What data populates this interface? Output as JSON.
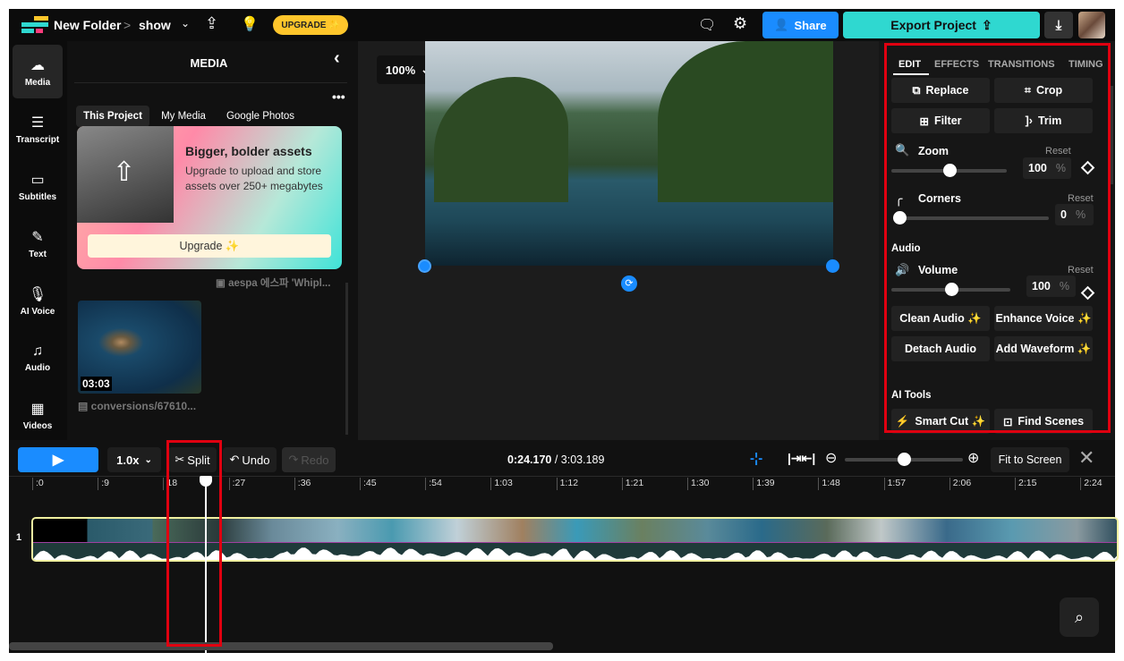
{
  "header": {
    "breadcrumb_folder": "New Folder",
    "breadcrumb_sep": ">",
    "project_name": "show",
    "upgrade": "UPGRADE ✨",
    "share": "Share",
    "export": "Export Project"
  },
  "rail": [
    {
      "label": "Media",
      "icon": "upload-cloud-icon"
    },
    {
      "label": "Transcript",
      "icon": "transcript-icon"
    },
    {
      "label": "Subtitles",
      "icon": "subtitles-icon"
    },
    {
      "label": "Text",
      "icon": "text-icon"
    },
    {
      "label": "AI Voice",
      "icon": "mic-icon"
    },
    {
      "label": "Audio",
      "icon": "music-icon"
    },
    {
      "label": "Videos",
      "icon": "film-icon"
    }
  ],
  "media": {
    "title": "MEDIA",
    "tabs": [
      "This Project",
      "My Media",
      "Google Photos"
    ],
    "promo": {
      "title": "Bigger, bolder assets",
      "text": "Upgrade to upload and store assets over 250+ megabytes",
      "button": "Upgrade ✨"
    },
    "items": [
      {
        "name": "aespa 에스파 'Whipl..."
      },
      {
        "name": "conversions/67610...",
        "duration": "03:03"
      }
    ]
  },
  "preview": {
    "zoom": "100%"
  },
  "edit": {
    "tabs": [
      "EDIT",
      "EFFECTS",
      "TRANSITIONS",
      "TIMING"
    ],
    "active_tab": "EDIT",
    "buttons": {
      "replace": "Replace",
      "crop": "Crop",
      "filter": "Filter",
      "trim": "Trim"
    },
    "zoom": {
      "label": "Zoom",
      "reset": "Reset",
      "value": "100",
      "unit": "%",
      "level": 0.5
    },
    "corners": {
      "label": "Corners",
      "reset": "Reset",
      "value": "0",
      "unit": "%",
      "level": 0
    },
    "audio_heading": "Audio",
    "volume": {
      "label": "Volume",
      "reset": "Reset",
      "value": "100",
      "unit": "%",
      "level": 0.5
    },
    "audio_buttons": [
      "Clean Audio ✨",
      "Enhance Voice ✨",
      "Detach Audio",
      "Add Waveform ✨"
    ],
    "ai_heading": "AI Tools",
    "ai_buttons": [
      "Smart Cut ✨",
      "Find Scenes"
    ]
  },
  "timeline": {
    "speed": "1.0x",
    "split": "Split",
    "undo": "Undo",
    "redo": "Redo",
    "current_time": "0:24.170",
    "total_time": "/ 3:03.189",
    "fit": "Fit to Screen",
    "track_number": "1",
    "ticks": [
      ":0",
      ":9",
      "18",
      ":27",
      ":36",
      ":45",
      ":54",
      "1:03",
      "1:12",
      "1:21",
      "1:30",
      "1:39",
      "1:48",
      "1:57",
      "2:06",
      "2:15",
      "2:24"
    ],
    "zoom_level": 0.5
  },
  "colors": {
    "accent": "#1a8cff",
    "export": "#2fd8d0",
    "upgrade": "#ffc62b",
    "highlight": "#e00010"
  }
}
